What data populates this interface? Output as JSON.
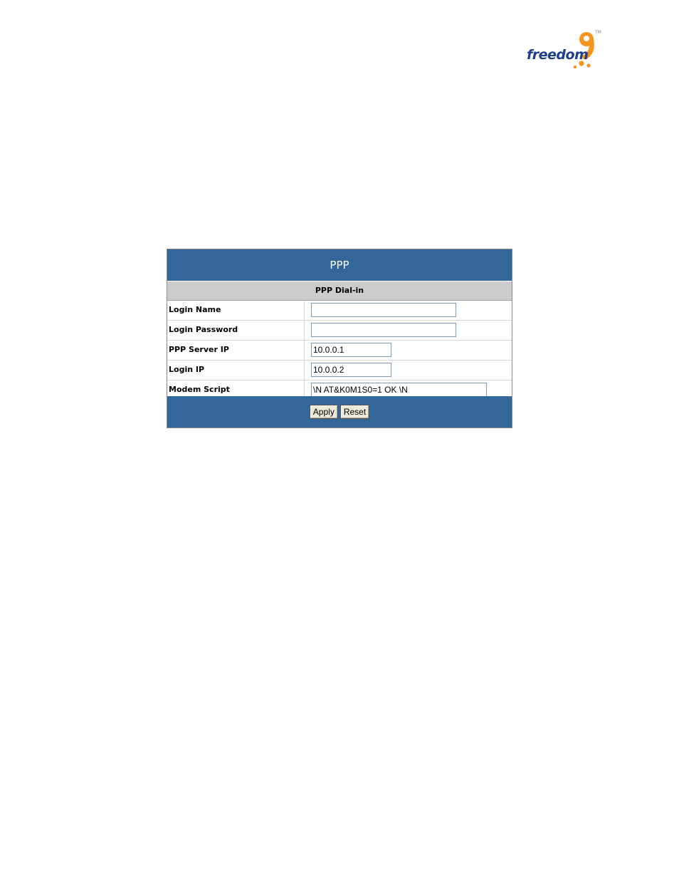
{
  "logo": {
    "word": "freedom",
    "digit": "9",
    "tm": "TM"
  },
  "panel": {
    "title": "PPP",
    "section": "PPP Dial-in",
    "fields": [
      {
        "label": "Login Name",
        "value": ""
      },
      {
        "label": "Login Password",
        "value": ""
      },
      {
        "label": "PPP Server IP",
        "value": "10.0.0.1"
      },
      {
        "label": "Login IP",
        "value": "10.0.0.2"
      },
      {
        "label": "Modem Script",
        "value": "\\N AT&K0M1S0=1 OK \\N"
      }
    ],
    "buttons": {
      "apply": "Apply",
      "reset": "Reset"
    }
  },
  "colors": {
    "header_blue": "#336699",
    "section_gray": "#cccccc",
    "logo_orange": "#f7941d",
    "logo_blue": "#1e3f8c"
  }
}
